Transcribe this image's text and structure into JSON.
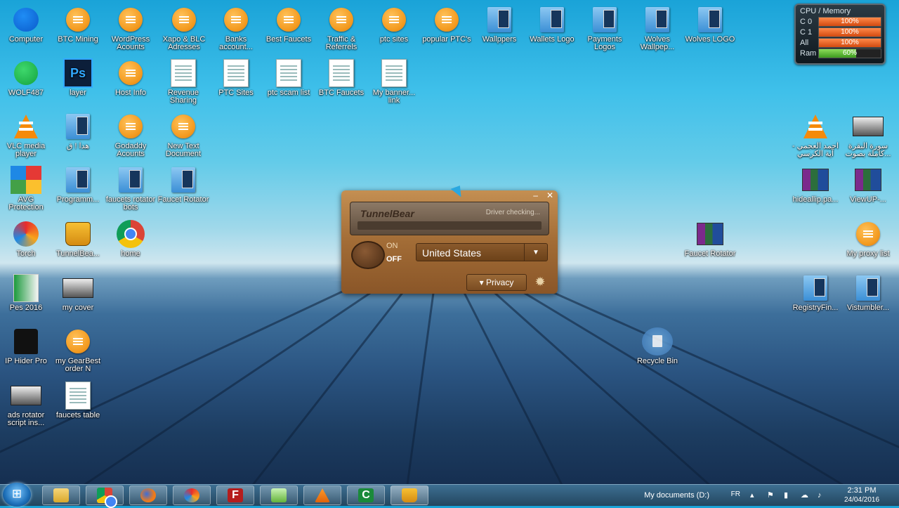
{
  "desktop": {
    "icons_left": [
      {
        "id": "computer",
        "label": "Computer"
      },
      {
        "id": "btc-mining",
        "label": "BTC Mining"
      },
      {
        "id": "wordpress",
        "label": "WordPress Acounts"
      },
      {
        "id": "xapo",
        "label": "Xapo & BLC Adresses"
      },
      {
        "id": "banks",
        "label": "Banks account..."
      },
      {
        "id": "best-faucets",
        "label": "Best Faucets"
      },
      {
        "id": "traffic",
        "label": "Traffic & Referrels"
      },
      {
        "id": "ptc-sites",
        "label": "ptc sites"
      },
      {
        "id": "popular-ptcs",
        "label": "popular PTC's"
      },
      {
        "id": "wallppers",
        "label": "Wallppers"
      },
      {
        "id": "wallets-logo",
        "label": "Wallets Logo"
      },
      {
        "id": "payments-logos",
        "label": "Payments Logos"
      },
      {
        "id": "wolves-wallpep",
        "label": "Wolves Wallpep..."
      },
      {
        "id": "wolves-logo",
        "label": "Wolves LOGO"
      },
      {
        "id": "wolf",
        "label": "WOLF487"
      },
      {
        "id": "layer",
        "label": "layer"
      },
      {
        "id": "host-info",
        "label": "Host Info"
      },
      {
        "id": "revenue",
        "label": "Revenue Sharing"
      },
      {
        "id": "ptc-sites-doc",
        "label": "PTC Sites"
      },
      {
        "id": "ptc-scam",
        "label": "ptc scam list"
      },
      {
        "id": "btc-faucets",
        "label": "BTC Faucets"
      },
      {
        "id": "my-banner",
        "label": "My banner... link"
      },
      {
        "id": "vlc",
        "label": "VLC media player"
      },
      {
        "id": "arabic-folder",
        "label": "هدا ! ق"
      },
      {
        "id": "godaddy",
        "label": "Godaddy Acounts"
      },
      {
        "id": "new-text",
        "label": "New Text Document"
      },
      {
        "id": "avg",
        "label": "AVG Protection"
      },
      {
        "id": "programm",
        "label": "Programm..."
      },
      {
        "id": "faucets-rotator-bots",
        "label": "faucets rotator bots"
      },
      {
        "id": "faucet-rotator-folder",
        "label": "Faucet Rotator"
      },
      {
        "id": "torch",
        "label": "Torch"
      },
      {
        "id": "tunnelbear",
        "label": "TunnelBea..."
      },
      {
        "id": "home",
        "label": "home"
      },
      {
        "id": "pes",
        "label": "Pes 2016"
      },
      {
        "id": "my-cover",
        "label": "my cover"
      },
      {
        "id": "ip-hider",
        "label": "IP Hider Pro"
      },
      {
        "id": "gearbest",
        "label": "my GearBest order N"
      },
      {
        "id": "ads-rotator",
        "label": "ads rotator script ins..."
      },
      {
        "id": "faucets-table",
        "label": "faucets table"
      }
    ],
    "icons_right": [
      {
        "id": "vlc-arabic",
        "label": "احمد العجمي - آية الكرسي"
      },
      {
        "id": "video-arabic",
        "label": "سورة البقرة كاملة بصوت..."
      },
      {
        "id": "hideallip",
        "label": "hideallip.pa..."
      },
      {
        "id": "viewup",
        "label": "ViewUP-..."
      },
      {
        "id": "faucet-rotator-rar",
        "label": "Faucet Rotator"
      },
      {
        "id": "my-proxy",
        "label": "My proxy list"
      },
      {
        "id": "registryfin",
        "label": "RegistryFin..."
      },
      {
        "id": "vistumbler",
        "label": "Vistumbler..."
      },
      {
        "id": "recycle-bin",
        "label": "Recycle Bin"
      }
    ]
  },
  "cpu_widget": {
    "title": "CPU / Memory",
    "rows": [
      {
        "label": "C 0",
        "value": "100%",
        "fraction": 1.0
      },
      {
        "label": "C 1",
        "value": "100%",
        "fraction": 1.0
      },
      {
        "label": "All",
        "value": "100%",
        "fraction": 1.0
      },
      {
        "label": "Ram",
        "value": "60%",
        "fraction": 0.6
      }
    ]
  },
  "tunnelbear": {
    "logo": "TunnelBear",
    "status": "Driver checking...",
    "on_label": "ON",
    "off_label": "OFF",
    "country": "United States",
    "privacy_label": "Privacy",
    "min_glyph": "–",
    "close_glyph": "✕"
  },
  "taskbar": {
    "documents_label": "My documents (D:)",
    "language": "FR",
    "time": "2:31 PM",
    "date": "24/04/2016"
  },
  "colors": {
    "accent_orange": "#f39a1f",
    "tunnelbear_wood": "#a26c36",
    "taskbar": "#2f5b7a"
  }
}
